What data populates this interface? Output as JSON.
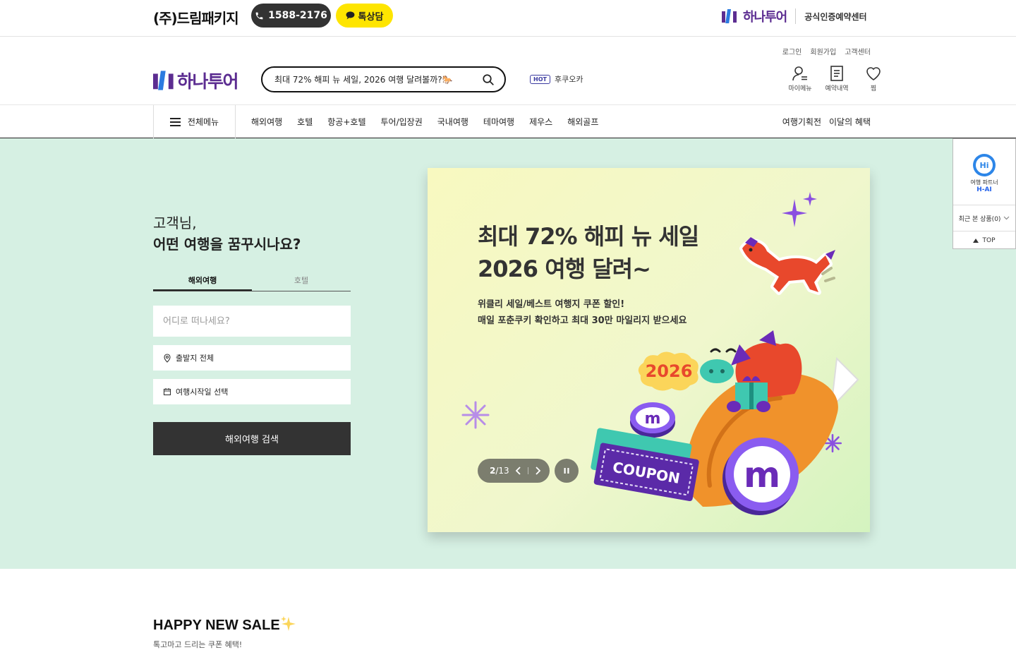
{
  "topbar": {
    "company": "(주)드림패키지",
    "phone": "1588-2176",
    "kakao": "톡상담",
    "brand": "하나투어",
    "cert": "공식인증예약센터"
  },
  "header": {
    "util_links": [
      "로그인",
      "회원가입",
      "고객센터"
    ],
    "logo": "하나투어",
    "search_value": "최대 72% 해피 뉴 세일, 2026 여행 달려볼까?🐎",
    "hot_badge": "HOT",
    "hot_keyword": "후쿠오카",
    "my_menu": "마이메뉴",
    "reservations": "예약내역",
    "wishlist": "찜"
  },
  "gnb": {
    "all_menu": "전체메뉴",
    "items": [
      "해외여행",
      "호텔",
      "항공+호텔",
      "투어/입장권",
      "국내여행",
      "테마여행",
      "제우스",
      "해외골프"
    ],
    "right": [
      "여행기획전",
      "이달의 혜택"
    ]
  },
  "hero": {
    "greeting_line1": "고객님,",
    "greeting_line2": "어떤 여행을 꿈꾸시나요?",
    "tabs": [
      "해외여행",
      "호텔"
    ],
    "destination_placeholder": "어디로 떠나세요?",
    "departure": "출발지 전체",
    "start_date": "여행시작일 선택",
    "search_button": "해외여행 검색"
  },
  "banner": {
    "title_line1": "최대 72% 해피 뉴 세일",
    "title_line2": "2026 여행 달려~",
    "desc_line1": "위클리 세일/베스트 여행지 쿠폰 할인!",
    "desc_line2": "매일 포춘쿠키 확인하고 최대 30만 마일리지 받으세요",
    "year_badge": "2026",
    "coupon": "COUPON",
    "slide_current": "2",
    "slide_total": "/13"
  },
  "float_panel": {
    "hai_caption": "여행 파트너",
    "hai_name": "H-AI",
    "recent": "최근 본 상품(0)",
    "top": "TOP"
  },
  "sale": {
    "title": "HAPPY NEW SALE",
    "subtitle": "톡고마고 드리는 쿠폰 혜택!"
  },
  "colors": {
    "brand_purple": "#5c2d91",
    "hero_bg": "#d6f0e3",
    "kakao_yellow": "#fee500",
    "dark_button": "#333333"
  }
}
